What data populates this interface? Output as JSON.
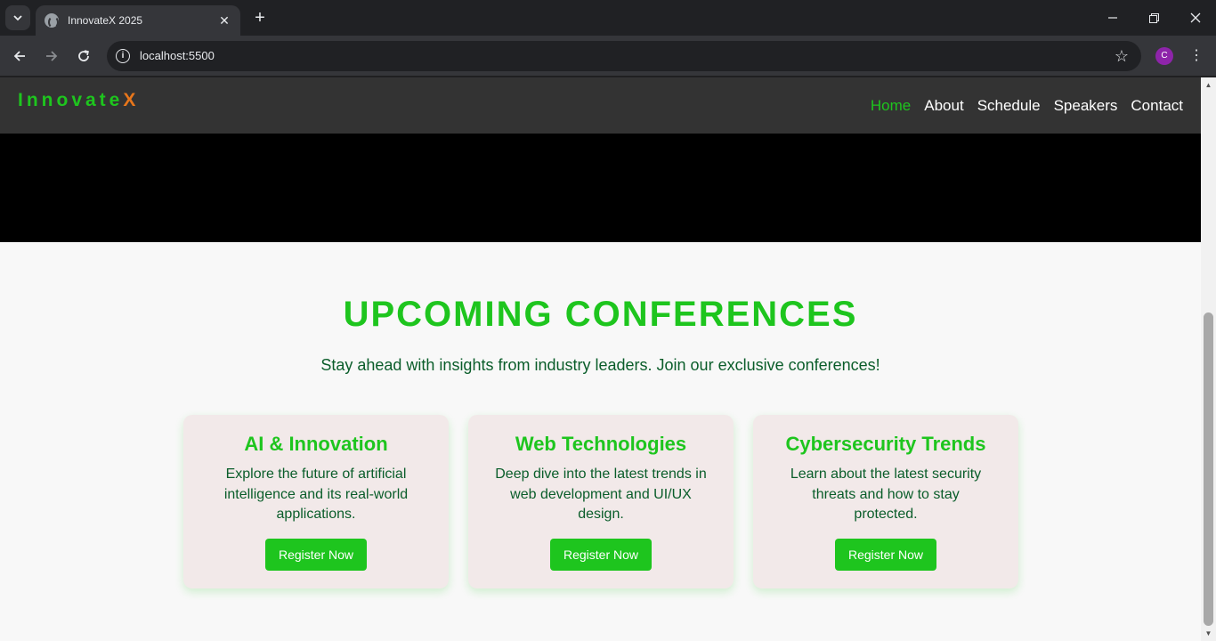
{
  "browser": {
    "tab_title": "InnovateX 2025",
    "url": "localhost:5500",
    "profile_initial": "C"
  },
  "site": {
    "logo_main": "Innovate",
    "logo_accent": "X",
    "nav": [
      {
        "label": "Home",
        "active": true
      },
      {
        "label": "About"
      },
      {
        "label": "Schedule"
      },
      {
        "label": "Speakers"
      },
      {
        "label": "Contact"
      }
    ]
  },
  "section": {
    "title": "UPCOMING CONFERENCES",
    "subtitle": "Stay ahead with insights from industry leaders. Join our exclusive conferences!"
  },
  "cards": [
    {
      "title": "AI & Innovation",
      "description": "Explore the future of artificial intelligence and its real-world applications.",
      "button": "Register Now"
    },
    {
      "title": "Web Technologies",
      "description": "Deep dive into the latest trends in web development and UI/UX design.",
      "button": "Register Now"
    },
    {
      "title": "Cybersecurity Trends",
      "description": "Learn about the latest security threats and how to stay protected.",
      "button": "Register Now"
    }
  ],
  "colors": {
    "accent_green": "#1ec51e",
    "text_green": "#0a5d2a",
    "logo_orange": "#e8761b",
    "header_bg": "#333333",
    "card_bg": "#f2e9e9"
  }
}
